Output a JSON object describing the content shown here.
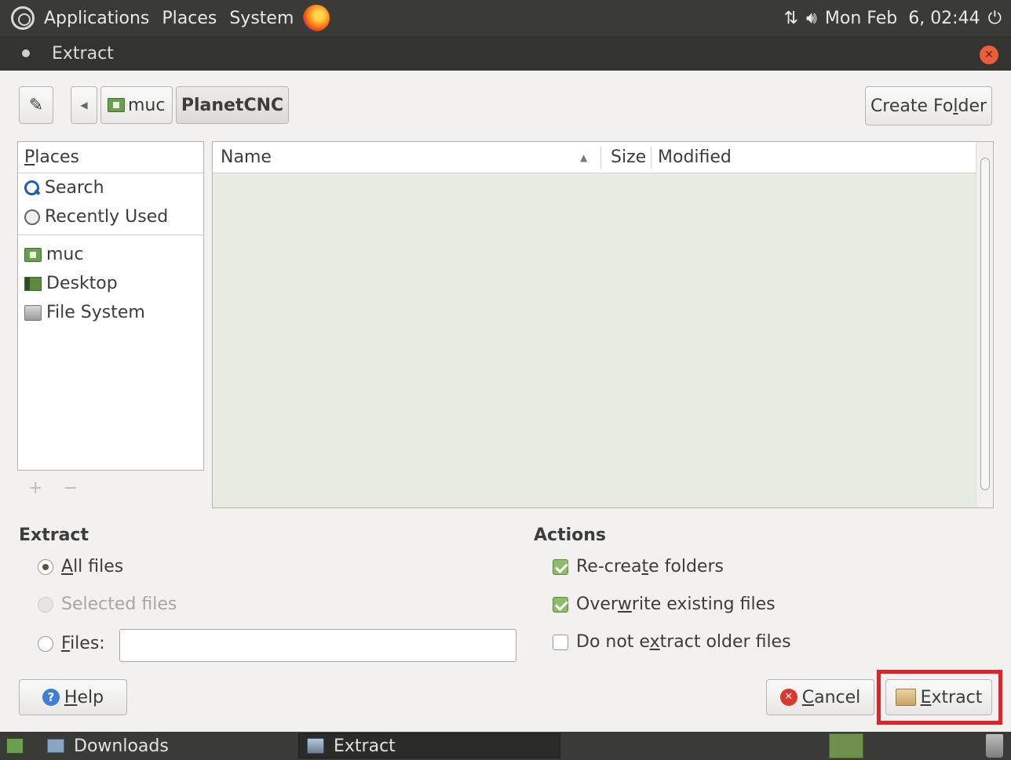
{
  "top_panel": {
    "menus": [
      "Applications",
      "Places",
      "System"
    ],
    "clock": "Mon Feb  6, 02:44"
  },
  "window": {
    "title": "Extract"
  },
  "pathbar": {
    "crumbs": [
      "muc",
      "PlanetCNC"
    ],
    "create_folder": {
      "pre": "Create Fo",
      "u": "l",
      "post": "der"
    }
  },
  "places": {
    "header": {
      "u": "P",
      "post": "laces"
    },
    "items": [
      "Search",
      "Recently Used",
      "muc",
      "Desktop",
      "File System"
    ]
  },
  "filelist": {
    "columns": [
      "Name",
      "Size",
      "Modified"
    ]
  },
  "extract_section": {
    "title": "Extract",
    "all_files": {
      "u": "A",
      "post": "ll files"
    },
    "selected_files": "Selected files",
    "files": {
      "u": "F",
      "post": "iles:"
    },
    "files_value": ""
  },
  "actions_section": {
    "title": "Actions",
    "recreate": {
      "pre": "Re-crea",
      "u": "t",
      "post": "e folders"
    },
    "overwrite": {
      "pre": "Over",
      "u": "w",
      "post": "rite existing files"
    },
    "no_older": {
      "pre": "Do not e",
      "u": "x",
      "post": "tract older files"
    }
  },
  "buttons": {
    "help": {
      "u": "H",
      "post": "elp"
    },
    "cancel": {
      "u": "C",
      "post": "ancel"
    },
    "extract": {
      "u": "E",
      "post": "xtract"
    }
  },
  "taskbar": {
    "tasks": [
      "Downloads",
      "Extract"
    ]
  },
  "colors": {
    "highlight": "#e0232b",
    "file_area_bg": "#e6ece0",
    "panel_bg": "#3a3a37"
  }
}
